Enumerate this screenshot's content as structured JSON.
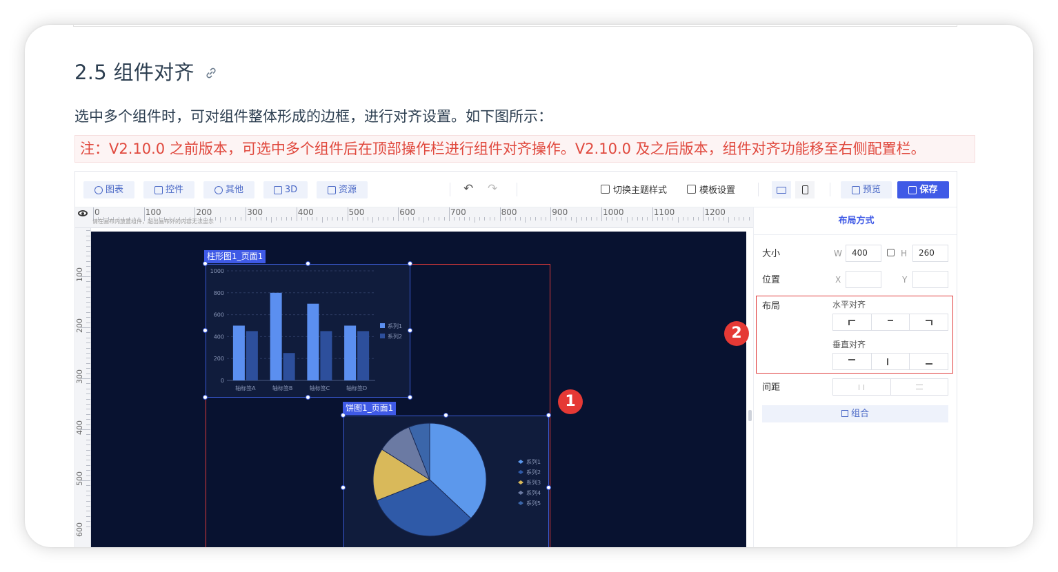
{
  "doc": {
    "heading": "2.5 组件对齐",
    "paragraph": "选中多个组件时，可对组件整体形成的边框，进行对齐设置。如下图所示：",
    "note": "注：V2.10.0 之前版本，可选中多个组件后在顶部操作栏进行组件对齐操作。V2.10.0 及之后版本，组件对齐功能移至右侧配置栏。"
  },
  "toolbar": {
    "tabs": [
      {
        "label": "图表",
        "icon": "chart-icon"
      },
      {
        "label": "控件",
        "icon": "control-icon"
      },
      {
        "label": "其他",
        "icon": "more-icon"
      },
      {
        "label": "3D",
        "icon": "cube-icon"
      },
      {
        "label": "资源",
        "icon": "resource-icon"
      }
    ],
    "undo": "↶",
    "redo": "↷",
    "theme_label": "切换主题样式",
    "template_label": "模板设置",
    "preview_label": "预览",
    "save_label": "保存"
  },
  "ruler": {
    "top": [
      "0",
      "100",
      "200",
      "300",
      "400",
      "500",
      "600",
      "700",
      "800",
      "900",
      "1000",
      "1100",
      "1200"
    ],
    "left": [
      "100",
      "200",
      "300",
      "400",
      "500",
      "600"
    ],
    "hint": "请在画布内放置组件，超出画布外的内容无法显示"
  },
  "canvas": {
    "bar_tag": "柱形图1_页面1",
    "pie_tag": "饼图1_页面1"
  },
  "badges": [
    "1",
    "2"
  ],
  "chart_data": [
    {
      "type": "bar",
      "categories": [
        "轴标签A",
        "轴标签B",
        "轴标签C",
        "轴标签D"
      ],
      "series": [
        {
          "name": "系列1",
          "values": [
            500,
            800,
            700,
            500
          ]
        },
        {
          "name": "系列2",
          "values": [
            450,
            250,
            450,
            450
          ]
        }
      ],
      "ylim": [
        0,
        1000
      ],
      "yticks": [
        "0",
        "200",
        "400",
        "600",
        "800",
        "1000"
      ],
      "colors": [
        "#5b8ff0",
        "#2d4f9c"
      ],
      "legend": "right"
    },
    {
      "type": "pie",
      "labels": [
        "系列1",
        "系列2",
        "系列3",
        "系列4",
        "系列5"
      ],
      "values": [
        37,
        32,
        15,
        10,
        6
      ],
      "colors": [
        "#5c98ec",
        "#2f5aa8",
        "#d9b95a",
        "#6b7aa3",
        "#3b66aa"
      ],
      "legend": "right"
    }
  ],
  "panel": {
    "title": "布局方式",
    "size_label": "大小",
    "w_letter": "W",
    "w_value": "400",
    "h_letter": "H",
    "h_value": "260",
    "pos_label": "位置",
    "x_letter": "X",
    "y_letter": "Y",
    "layout_label": "布局",
    "h_align_label": "水平对齐",
    "v_align_label": "垂直对齐",
    "spacing_label": "间距",
    "group_label": "组合"
  }
}
